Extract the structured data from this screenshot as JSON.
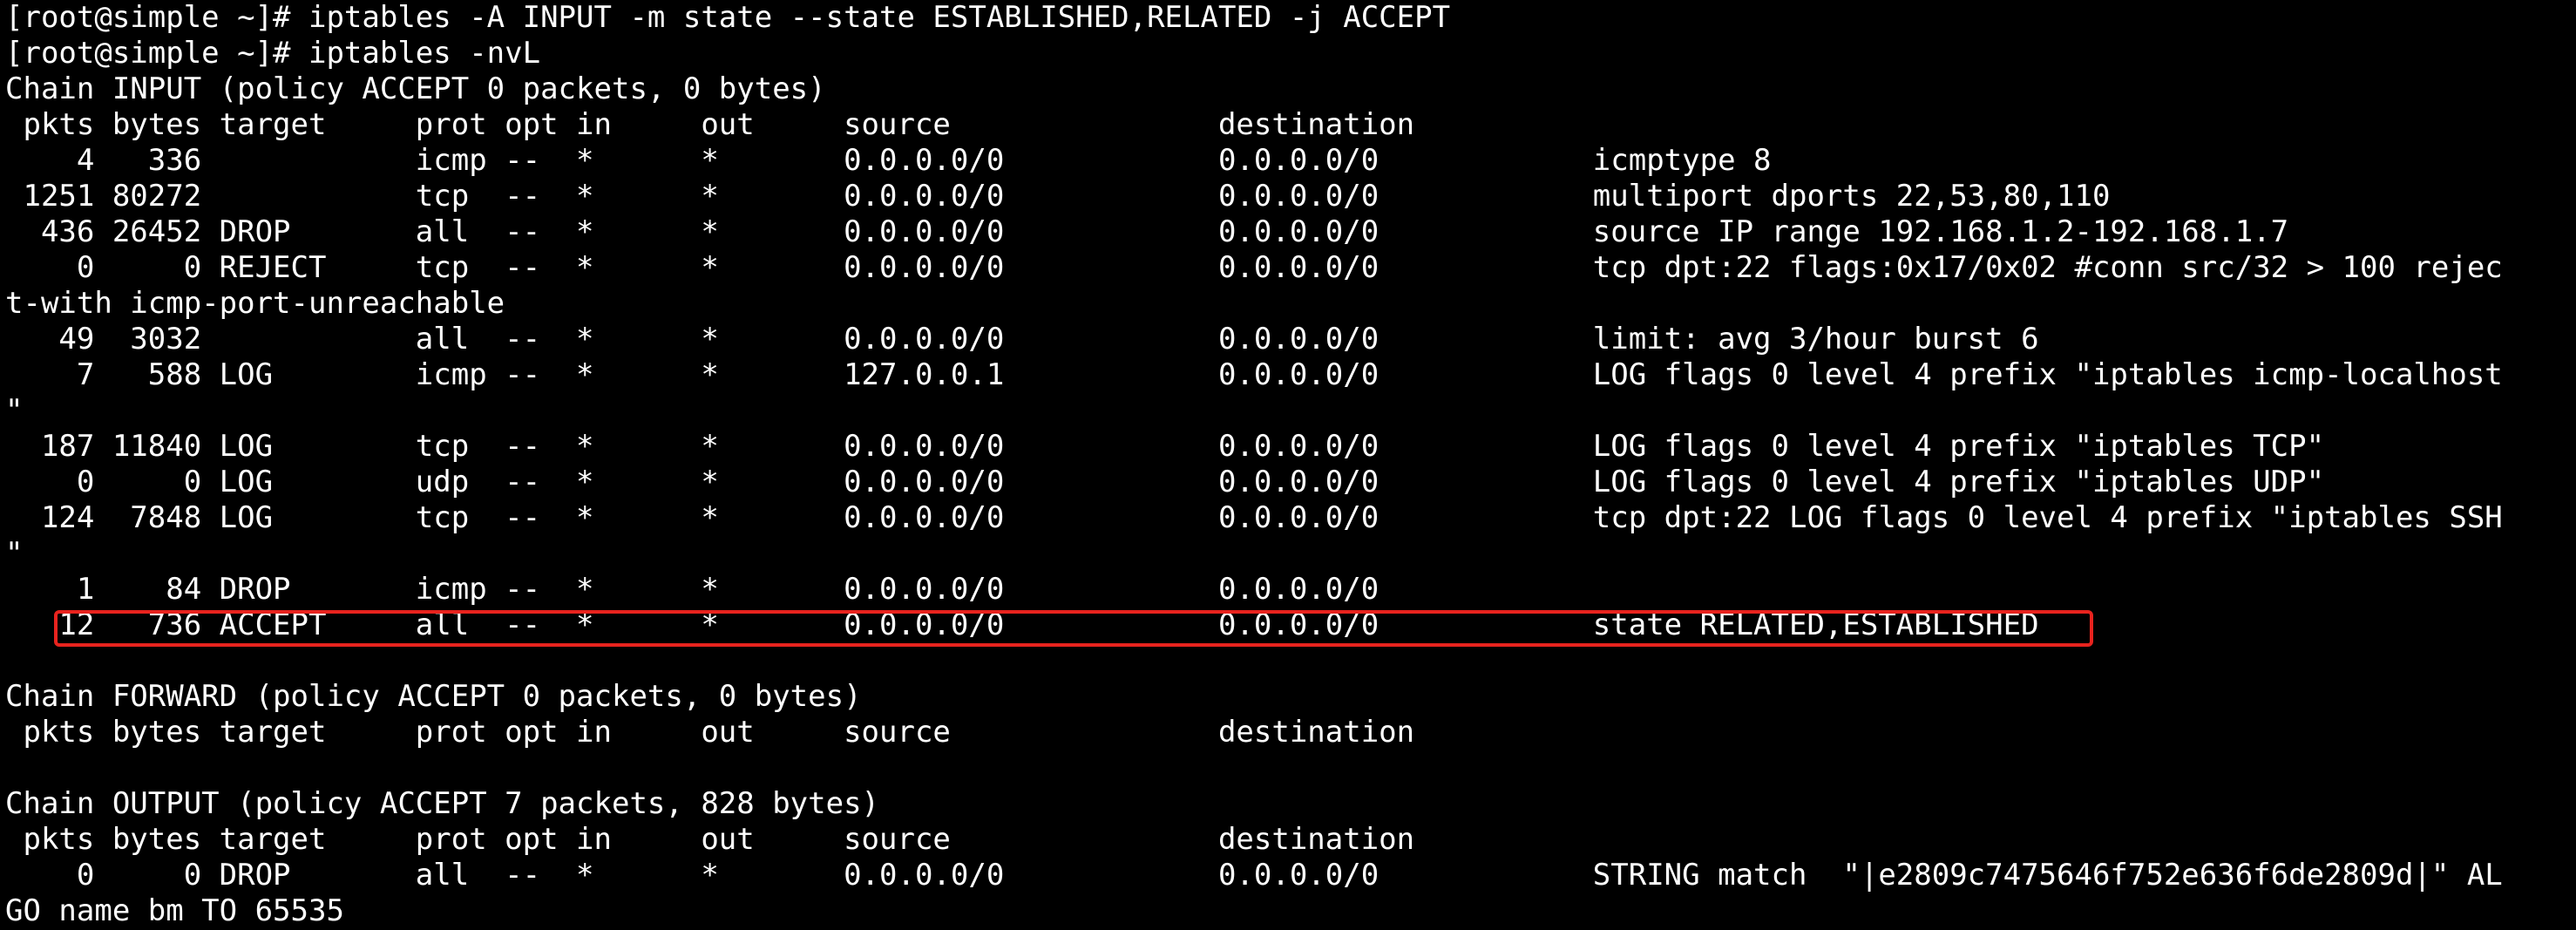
{
  "terminal": {
    "lines": [
      "[root@simple ~]# iptables -A INPUT -m state --state ESTABLISHED,RELATED -j ACCEPT",
      "[root@simple ~]# iptables -nvL",
      "Chain INPUT (policy ACCEPT 0 packets, 0 bytes)",
      " pkts bytes target     prot opt in     out     source               destination         ",
      "    4   336            icmp --  *      *       0.0.0.0/0            0.0.0.0/0            icmptype 8",
      " 1251 80272            tcp  --  *      *       0.0.0.0/0            0.0.0.0/0            multiport dports 22,53,80,110",
      "  436 26452 DROP       all  --  *      *       0.0.0.0/0            0.0.0.0/0            source IP range 192.168.1.2-192.168.1.7",
      "    0     0 REJECT     tcp  --  *      *       0.0.0.0/0            0.0.0.0/0            tcp dpt:22 flags:0x17/0x02 #conn src/32 > 100 rejec",
      "t-with icmp-port-unreachable",
      "   49  3032            all  --  *      *       0.0.0.0/0            0.0.0.0/0            limit: avg 3/hour burst 6",
      "    7   588 LOG        icmp --  *      *       127.0.0.1            0.0.0.0/0            LOG flags 0 level 4 prefix \"iptables icmp-localhost",
      "\"",
      "  187 11840 LOG        tcp  --  *      *       0.0.0.0/0            0.0.0.0/0            LOG flags 0 level 4 prefix \"iptables TCP\"",
      "    0     0 LOG        udp  --  *      *       0.0.0.0/0            0.0.0.0/0            LOG flags 0 level 4 prefix \"iptables UDP\"",
      "  124  7848 LOG        tcp  --  *      *       0.0.0.0/0            0.0.0.0/0            tcp dpt:22 LOG flags 0 level 4 prefix \"iptables SSH",
      "\"",
      "    1    84 DROP       icmp --  *      *       0.0.0.0/0            0.0.0.0/0           ",
      "   12   736 ACCEPT     all  --  *      *       0.0.0.0/0            0.0.0.0/0            state RELATED,ESTABLISHED",
      "",
      "Chain FORWARD (policy ACCEPT 0 packets, 0 bytes)",
      " pkts bytes target     prot opt in     out     source               destination         ",
      "",
      "Chain OUTPUT (policy ACCEPT 7 packets, 828 bytes)",
      " pkts bytes target     prot opt in     out     source               destination         ",
      "    0     0 DROP       all  --  *      *       0.0.0.0/0            0.0.0.0/0            STRING match  \"|e2809c7475646f752e636f6de2809d|\" AL",
      "GO name bm TO 65535"
    ],
    "highlighted_line_index": 17,
    "colors": {
      "background": "#000000",
      "text": "#ffffff",
      "highlight_border": "#e8231e"
    }
  }
}
